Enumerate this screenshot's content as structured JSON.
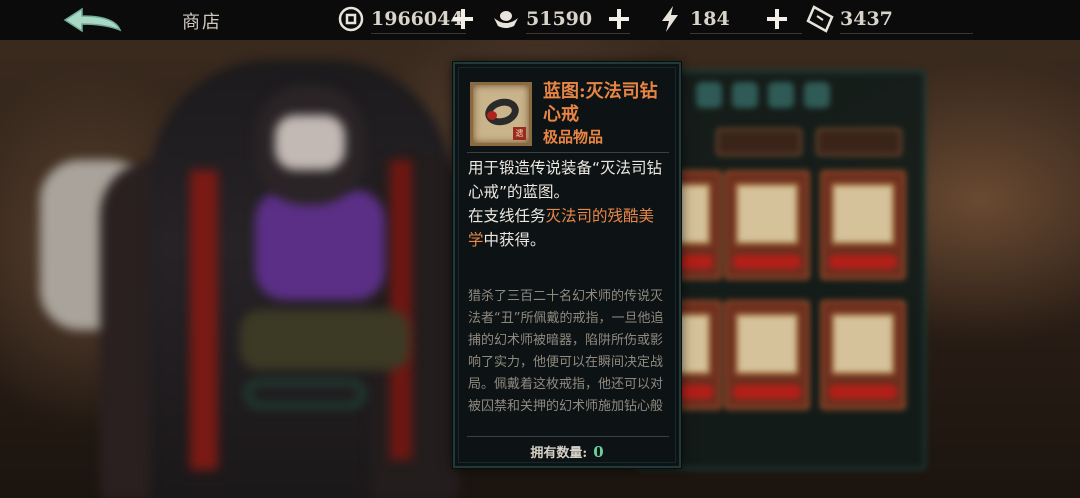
{
  "topbar": {
    "title": "商店",
    "resources": [
      {
        "name": "copper-coin",
        "value": "1966044"
      },
      {
        "name": "silver-ingot",
        "value": "51590"
      },
      {
        "name": "energy",
        "value": "184"
      },
      {
        "name": "ticket",
        "value": "3437"
      }
    ]
  },
  "tooltip": {
    "item_name": "蓝图:灭法司钻心戒",
    "grade": "极品物品",
    "desc_part1": "用于锻造传说装备“灭法司钻心戒”的蓝图。",
    "desc_part2": "在支线任务",
    "desc_quest": "灭法司的残酷美学",
    "desc_part3": "中获得。",
    "lore": "猎杀了三百二十名幻术师的传说灭法者“丑”所佩戴的戒指，一旦他追捕的幻术师被暗器，陷阱所伤或影响了实力，他便可以在瞬间决定战局。佩戴着这枚戒指，他还可以对被囚禁和关押的幻术师施加钻心般",
    "owned_label": "拥有数量:",
    "owned_value": "0",
    "icon_stamp": "遗"
  },
  "colors": {
    "accent_orange": "#e88544",
    "owned_green": "#6ccf9a",
    "frame_teal": "#1e3b3a"
  }
}
